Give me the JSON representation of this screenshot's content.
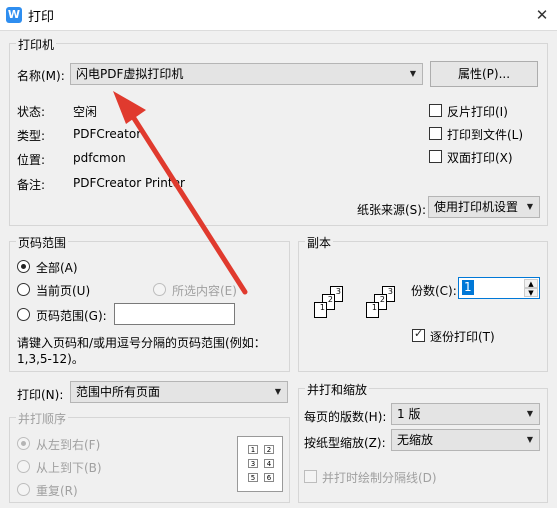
{
  "window": {
    "title": "打印",
    "app_icon": "wps-w-icon",
    "close_label": "✕"
  },
  "printer": {
    "group_label": "打印机",
    "name_label": "名称(M):",
    "name_value": "闪电PDF虚拟打印机",
    "properties_label": "属性(P)...",
    "status_label": "状态:",
    "status_value": "空闲",
    "type_label": "类型:",
    "type_value": "PDFCreator",
    "location_label": "位置:",
    "location_value": "pdfcmon",
    "comment_label": "备注:",
    "comment_value": "PDFCreator Printer",
    "reverse_print": "反片打印(I)",
    "print_to_file": "打印到文件(L)",
    "duplex": "双面打印(X)",
    "paper_source_label": "纸张来源(S):",
    "paper_source_value": "使用打印机设置"
  },
  "page_range": {
    "group_label": "页码范围",
    "all": "全部(A)",
    "current": "当前页(U)",
    "selection": "所选内容(E)",
    "pages": "页码范围(G):",
    "pages_value": "",
    "hint_line1": "请键入页码和/或用逗号分隔的页码范围(例如：",
    "hint_line2": "1,3,5-12)。"
  },
  "copies": {
    "group_label": "副本",
    "count_label": "份数(C):",
    "count_value": "1",
    "collate_label": "逐份打印(T)",
    "collate_checked": true,
    "stack_pages": [
      "1",
      "2",
      "3"
    ]
  },
  "print_what": {
    "label": "打印(N):",
    "value": "范围中所有页面"
  },
  "merge_order": {
    "group_label": "并打顺序",
    "left_to_right": "从左到右(F)",
    "top_to_bottom": "从上到下(B)",
    "repeat": "重复(R)",
    "grid": [
      [
        "1",
        "2"
      ],
      [
        "3",
        "4"
      ],
      [
        "5",
        "6"
      ]
    ]
  },
  "scale": {
    "group_label": "并打和缩放",
    "pages_per_sheet_label": "每页的版数(H):",
    "pages_per_sheet_value": "1 版",
    "scale_label": "按纸型缩放(Z):",
    "scale_value": "无缩放",
    "draw_lines": "并打时绘制分隔线(D)"
  },
  "colors": {
    "arrow": "#e03a2e",
    "accent": "#2e8ef0"
  }
}
